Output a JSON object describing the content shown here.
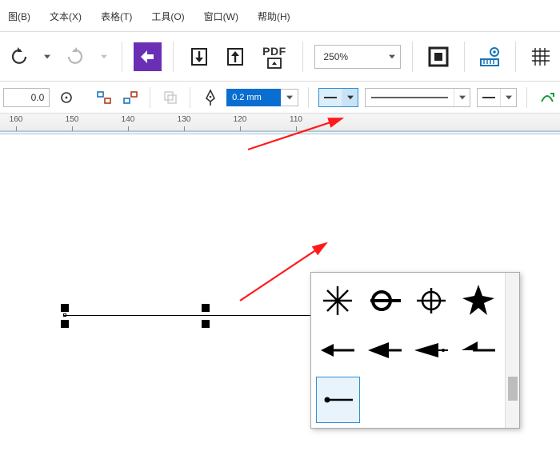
{
  "menubar": {
    "items": [
      "图(B)",
      "文本(X)",
      "表格(T)",
      "工具(O)",
      "窗口(W)",
      "帮助(H)"
    ]
  },
  "toolbar1": {
    "pdf_label_top": "PDF",
    "zoom": "250%"
  },
  "toolbar2": {
    "numfield_value": "0.0",
    "outline_width": "0.2 mm"
  },
  "ruler": {
    "ticks": [
      160,
      150,
      140,
      130,
      120,
      110
    ]
  },
  "arrowhead_panel": {
    "options": [
      "burst-star",
      "ring-bar",
      "crosshair",
      "spark-star",
      "arrow-left-solid",
      "triangle-left-solid",
      "triangle-left-thin",
      "half-arrow-left",
      "dot-line"
    ],
    "selected_index": 8
  }
}
